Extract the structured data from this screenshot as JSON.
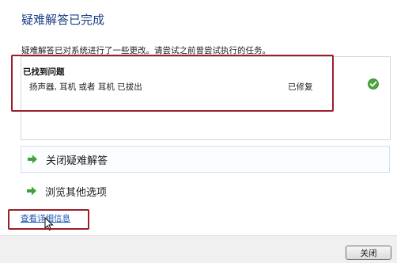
{
  "header": {
    "title": "疑难解答已完成",
    "description": "疑难解答已对系统进行了一些更改。请尝试之前曾尝试执行的任务。"
  },
  "problems": {
    "heading": "已找到问题",
    "items": [
      {
        "text": "扬声器, 耳机 或者 耳机 已拔出",
        "status": "已修复",
        "status_icon": "check-circle-icon"
      }
    ]
  },
  "options": [
    {
      "label": "关闭疑难解答",
      "icon": "green-arrow-icon"
    },
    {
      "label": "浏览其他选项",
      "icon": "green-arrow-icon"
    }
  ],
  "details_link": "查看详细信息",
  "footer": {
    "close_label": "关闭"
  },
  "colors": {
    "title": "#1a3f86",
    "link": "#1a56b5",
    "arrow": "#3aa33a",
    "check": "#4aa83a",
    "highlight": "#9a1f2a"
  }
}
